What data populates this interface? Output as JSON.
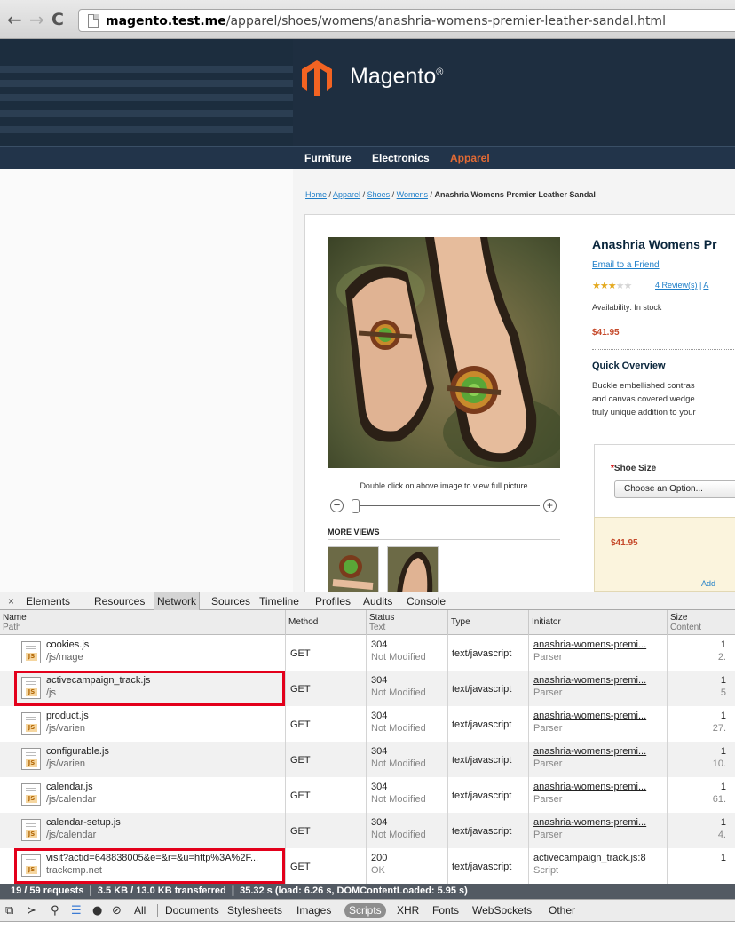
{
  "browser": {
    "url_host": "magento.test.me",
    "url_path": "/apparel/shoes/womens/anashria-womens-premier-leather-sandal.html"
  },
  "site": {
    "logo_text": "Magento",
    "logo_reg": "®",
    "nav": [
      "Furniture",
      "Electronics",
      "Apparel"
    ],
    "breadcrumb": [
      "Home",
      "Apparel",
      "Shoes",
      "Womens"
    ],
    "breadcrumb_sep": " / ",
    "breadcrumb_current": "Anashria Womens Premier Leather Sandal"
  },
  "product": {
    "title": "Anashria Womens Pr",
    "email_friend": "Email to a Friend",
    "rating_stars": 3,
    "rating_max": 5,
    "reviews_link": "4 Review(s)",
    "reviews_sep": " | ",
    "reviews_trailing": "A",
    "availability": "Availability: In stock",
    "price": "$41.95",
    "image_caption": "Double click on above image to view full picture",
    "zoom_level": 0,
    "more_views": "MORE VIEWS",
    "quick_overview_title": "Quick Overview",
    "quick_overview_lines": [
      "Buckle embellished contras",
      "and canvas covered wedge",
      "truly unique addition to your"
    ],
    "shoe_size_required": "*",
    "shoe_size_label": "Shoe Size",
    "shoe_size_select": "Choose an Option...",
    "price_box": "$41.95",
    "add_label": "Add"
  },
  "devtools": {
    "close_icon": "×",
    "tabs": [
      "Elements",
      "Resources",
      "Network",
      "Sources",
      "Timeline",
      "Profiles",
      "Audits",
      "Console"
    ],
    "active_tab": "Network",
    "columns": {
      "name": "Name",
      "name_sub": "Path",
      "method": "Method",
      "status": "Status",
      "status_sub": "Text",
      "type": "Type",
      "initiator": "Initiator",
      "size": "Size",
      "size_sub": "Content"
    },
    "requests": [
      {
        "name": "cookies.js",
        "path": "/js/mage",
        "method": "GET",
        "status": "304",
        "status_text": "Not Modified",
        "type": "text/javascript",
        "initiator": "anashria-womens-premi...",
        "initiator_type": "Parser",
        "size": "1",
        "content": "2."
      },
      {
        "name": "activecampaign_track.js",
        "path": "/js",
        "method": "GET",
        "status": "304",
        "status_text": "Not Modified",
        "type": "text/javascript",
        "initiator": "anashria-womens-premi...",
        "initiator_type": "Parser",
        "size": "1",
        "content": "5"
      },
      {
        "name": "product.js",
        "path": "/js/varien",
        "method": "GET",
        "status": "304",
        "status_text": "Not Modified",
        "type": "text/javascript",
        "initiator": "anashria-womens-premi...",
        "initiator_type": "Parser",
        "size": "1",
        "content": "27."
      },
      {
        "name": "configurable.js",
        "path": "/js/varien",
        "method": "GET",
        "status": "304",
        "status_text": "Not Modified",
        "type": "text/javascript",
        "initiator": "anashria-womens-premi...",
        "initiator_type": "Parser",
        "size": "1",
        "content": "10."
      },
      {
        "name": "calendar.js",
        "path": "/js/calendar",
        "method": "GET",
        "status": "304",
        "status_text": "Not Modified",
        "type": "text/javascript",
        "initiator": "anashria-womens-premi...",
        "initiator_type": "Parser",
        "size": "1",
        "content": "61."
      },
      {
        "name": "calendar-setup.js",
        "path": "/js/calendar",
        "method": "GET",
        "status": "304",
        "status_text": "Not Modified",
        "type": "text/javascript",
        "initiator": "anashria-womens-premi...",
        "initiator_type": "Parser",
        "size": "1",
        "content": "4."
      },
      {
        "name": "visit?actid=648838005&e=&r=&u=http%3A%2F...",
        "path": "trackcmp.net",
        "method": "GET",
        "status": "200",
        "status_text": "OK",
        "type": "text/javascript",
        "initiator": "activecampaign_track.js:8",
        "initiator_type": "Script",
        "size": "1",
        "content": ""
      }
    ],
    "highlighted_rows": [
      1,
      6
    ],
    "summary": "19 / 59 requests  ❘  3.5 KB / 13.0 KB transferred  ❘  35.32 s (load: 6.26 s, DOMContentLoaded: 5.95 s)",
    "filters": [
      "All",
      "Documents",
      "Stylesheets",
      "Images",
      "Scripts",
      "XHR",
      "Fonts",
      "WebSockets",
      "Other"
    ],
    "active_filter": "Scripts"
  },
  "colors": {
    "highlight": "#e3001b",
    "brand_orange": "#f26322",
    "nav_active": "#e26a34",
    "price": "#c5492a"
  }
}
